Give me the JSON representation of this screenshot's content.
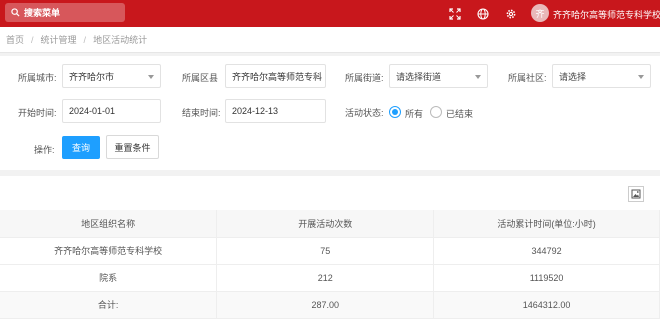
{
  "topbar": {
    "search_placeholder": "搜索菜单",
    "icons": [
      "fullscreen-icon",
      "globe-icon",
      "gear-icon"
    ],
    "avatar_text": "齐",
    "user_name": "齐齐哈尔高等师范专科学校"
  },
  "breadcrumb": [
    "首页",
    "统计管理",
    "地区活动统计"
  ],
  "filters": {
    "city_label": "所属城市:",
    "city_value": "齐齐哈尔市",
    "district_label": "所属区县",
    "district_value": "齐齐哈尔高等师范专科",
    "street_label": "所属街道:",
    "street_placeholder": "请选择街道",
    "community_label": "所属社区:",
    "community_placeholder": "请选择",
    "start_label": "开始时间:",
    "start_value": "2024-01-01",
    "end_label": "结束时间:",
    "end_value": "2024-12-13",
    "status_label": "活动状态:",
    "status_option_all": "所有",
    "status_option_ended": "已结束",
    "status_selected": "所有",
    "ops_label": "操作:",
    "query_button": "查询",
    "reset_button": "重置条件"
  },
  "table": {
    "headers": [
      "地区组织名称",
      "开展活动次数",
      "活动累计时间(单位:小时)"
    ],
    "rows": [
      [
        "齐齐哈尔高等师范专科学校",
        "75",
        "344792"
      ],
      [
        "院系",
        "212",
        "1119520"
      ]
    ],
    "total": [
      "合计:",
      "287.00",
      "1464312.00"
    ]
  },
  "colors": {
    "brand": "#c8171c",
    "primary": "#1e9fff"
  }
}
